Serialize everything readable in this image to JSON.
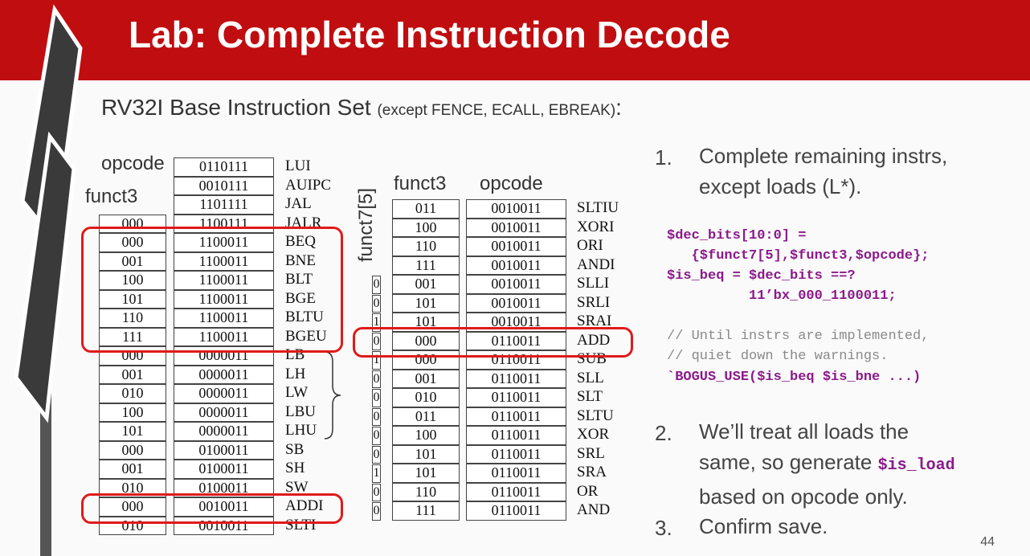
{
  "slide": {
    "title": "Lab: Complete Instruction Decode",
    "subtitle_main": "RV32I Base Instruction Set ",
    "subtitle_small": "(except FENCE, ECALL, EBREAK)",
    "subtitle_end": ":",
    "page_number": "44"
  },
  "left_table": {
    "header_opcode": "opcode",
    "header_funct3": "funct3",
    "rows": [
      {
        "funct3": "",
        "opcode": "0110111",
        "name": "LUI"
      },
      {
        "funct3": "",
        "opcode": "0010111",
        "name": "AUIPC"
      },
      {
        "funct3": "",
        "opcode": "1101111",
        "name": "JAL"
      },
      {
        "funct3": "000",
        "opcode": "1100111",
        "name": "JALR"
      },
      {
        "funct3": "000",
        "opcode": "1100011",
        "name": "BEQ"
      },
      {
        "funct3": "001",
        "opcode": "1100011",
        "name": "BNE"
      },
      {
        "funct3": "100",
        "opcode": "1100011",
        "name": "BLT"
      },
      {
        "funct3": "101",
        "opcode": "1100011",
        "name": "BGE"
      },
      {
        "funct3": "110",
        "opcode": "1100011",
        "name": "BLTU"
      },
      {
        "funct3": "111",
        "opcode": "1100011",
        "name": "BGEU"
      },
      {
        "funct3": "000",
        "opcode": "0000011",
        "name": "LB"
      },
      {
        "funct3": "001",
        "opcode": "0000011",
        "name": "LH"
      },
      {
        "funct3": "010",
        "opcode": "0000011",
        "name": "LW"
      },
      {
        "funct3": "100",
        "opcode": "0000011",
        "name": "LBU"
      },
      {
        "funct3": "101",
        "opcode": "0000011",
        "name": "LHU"
      },
      {
        "funct3": "000",
        "opcode": "0100011",
        "name": "SB"
      },
      {
        "funct3": "001",
        "opcode": "0100011",
        "name": "SH"
      },
      {
        "funct3": "010",
        "opcode": "0100011",
        "name": "SW"
      },
      {
        "funct3": "000",
        "opcode": "0010011",
        "name": "ADDI"
      },
      {
        "funct3": "010",
        "opcode": "0010011",
        "name": "SLTI"
      }
    ]
  },
  "right_table": {
    "header_funct7": "funct7[5]",
    "header_funct3": "funct3",
    "header_opcode": "opcode",
    "rows": [
      {
        "funct7": "",
        "funct3": "011",
        "opcode": "0010011",
        "name": "SLTIU"
      },
      {
        "funct7": "",
        "funct3": "100",
        "opcode": "0010011",
        "name": "XORI"
      },
      {
        "funct7": "",
        "funct3": "110",
        "opcode": "0010011",
        "name": "ORI"
      },
      {
        "funct7": "",
        "funct3": "111",
        "opcode": "0010011",
        "name": "ANDI"
      },
      {
        "funct7": "0",
        "funct3": "001",
        "opcode": "0010011",
        "name": "SLLI"
      },
      {
        "funct7": "0",
        "funct3": "101",
        "opcode": "0010011",
        "name": "SRLI"
      },
      {
        "funct7": "1",
        "funct3": "101",
        "opcode": "0010011",
        "name": "SRAI"
      },
      {
        "funct7": "0",
        "funct3": "000",
        "opcode": "0110011",
        "name": "ADD"
      },
      {
        "funct7": "1",
        "funct3": "000",
        "opcode": "0110011",
        "name": "SUB"
      },
      {
        "funct7": "0",
        "funct3": "001",
        "opcode": "0110011",
        "name": "SLL"
      },
      {
        "funct7": "0",
        "funct3": "010",
        "opcode": "0110011",
        "name": "SLT"
      },
      {
        "funct7": "0",
        "funct3": "011",
        "opcode": "0110011",
        "name": "SLTU"
      },
      {
        "funct7": "0",
        "funct3": "100",
        "opcode": "0110011",
        "name": "XOR"
      },
      {
        "funct7": "0",
        "funct3": "101",
        "opcode": "0110011",
        "name": "SRL"
      },
      {
        "funct7": "1",
        "funct3": "101",
        "opcode": "0110011",
        "name": "SRA"
      },
      {
        "funct7": "0",
        "funct3": "110",
        "opcode": "0110011",
        "name": "OR"
      },
      {
        "funct7": "0",
        "funct3": "111",
        "opcode": "0110011",
        "name": "AND"
      }
    ]
  },
  "steps": {
    "s1_num": "1.",
    "s1_line1": "Complete remaining instrs,",
    "s1_line2": "except loads (L*).",
    "code_line1": "$dec_bits[10:0] =",
    "code_line2": "   {$funct7[5],$funct3,$opcode};",
    "code_line3": "$is_beq = $dec_bits ==?",
    "code_line4": "          11’bx_000_1100011;",
    "comment_line1": "// Until instrs are implemented,",
    "comment_line2": "// quiet down the warnings.",
    "code_line5": "`BOGUS_USE($is_beq $is_bne ...)",
    "s2_num": "2.",
    "s2_line1": "We’ll treat all loads the",
    "s2_line2a": "same, so generate ",
    "s2_code": "$is_load",
    "s2_line3": "based on opcode only.",
    "s3_num": "3.",
    "s3_line": "Confirm save."
  },
  "colors": {
    "banner": "#c00d10",
    "highlight_box": "#e01a1a",
    "code": "#8b1a8b",
    "comment": "#8a8a8a"
  }
}
